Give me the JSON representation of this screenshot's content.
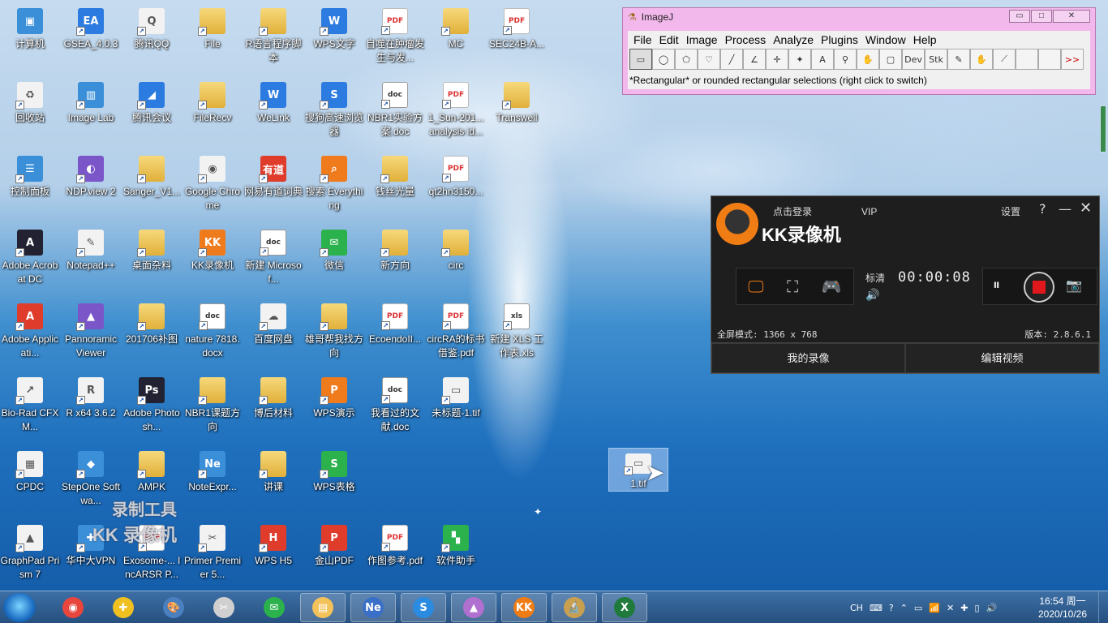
{
  "desktop_icons": [
    {
      "label": "计算机",
      "kind": "sys",
      "glyph": "▣"
    },
    {
      "label": "GSEA_4.0.3",
      "kind": "blue",
      "glyph": "EA"
    },
    {
      "label": "腾讯QQ",
      "kind": "white",
      "glyph": "Q"
    },
    {
      "label": "File",
      "kind": "folder",
      "glyph": ""
    },
    {
      "label": "R语言程序脚本",
      "kind": "folder",
      "glyph": ""
    },
    {
      "label": "WPS文字",
      "kind": "blue",
      "glyph": "W"
    },
    {
      "label": "自噬在肿瘤发生与发...",
      "kind": "pdf",
      "glyph": "PDF"
    },
    {
      "label": "MC",
      "kind": "folder",
      "glyph": ""
    },
    {
      "label": "SEC24B-A...",
      "kind": "pdf",
      "glyph": "PDF"
    },
    {
      "label": "回收站",
      "kind": "white",
      "glyph": "♻"
    },
    {
      "label": "Image Lab",
      "kind": "sys",
      "glyph": "▥"
    },
    {
      "label": "腾讯会议",
      "kind": "blue",
      "glyph": "◢"
    },
    {
      "label": "FileRecv",
      "kind": "folder",
      "glyph": ""
    },
    {
      "label": "WeLink",
      "kind": "blue",
      "glyph": "W"
    },
    {
      "label": "搜狗高速浏览器",
      "kind": "blue",
      "glyph": "S"
    },
    {
      "label": "NBR1实验方案.doc",
      "kind": "doc",
      "glyph": "doc"
    },
    {
      "label": "1_Sun-201... analysis id...",
      "kind": "pdf",
      "glyph": "PDF"
    },
    {
      "label": "Transwell",
      "kind": "folder",
      "glyph": ""
    },
    {
      "label": "控制面板",
      "kind": "sys",
      "glyph": "☰"
    },
    {
      "label": "NDP.view 2",
      "kind": "purple",
      "glyph": "◐"
    },
    {
      "label": "Sanger_V1...",
      "kind": "folder",
      "glyph": ""
    },
    {
      "label": "Google Chrome",
      "kind": "white",
      "glyph": "◉"
    },
    {
      "label": "网易有道词典",
      "kind": "red",
      "glyph": "有道"
    },
    {
      "label": "搜索 Everything",
      "kind": "orange",
      "glyph": "⌕"
    },
    {
      "label": "钱丝光量",
      "kind": "folder",
      "glyph": ""
    },
    {
      "label": "qt2hn3150...",
      "kind": "pdf",
      "glyph": "PDF"
    },
    {
      "label": "Adobe Acrobat DC",
      "kind": "dark",
      "glyph": "A"
    },
    {
      "label": "Notepad++",
      "kind": "white",
      "glyph": "✎"
    },
    {
      "label": "桌面杂料",
      "kind": "folder",
      "glyph": ""
    },
    {
      "label": "KK录像机",
      "kind": "orange",
      "glyph": "KK"
    },
    {
      "label": "新建 Microsof...",
      "kind": "doc",
      "glyph": "doc"
    },
    {
      "label": "微信",
      "kind": "green",
      "glyph": "✉"
    },
    {
      "label": "新方向",
      "kind": "folder",
      "glyph": ""
    },
    {
      "label": "circ",
      "kind": "folder",
      "glyph": ""
    },
    {
      "label": "Adobe Applicati...",
      "kind": "red",
      "glyph": "A"
    },
    {
      "label": "Pannoramic Viewer",
      "kind": "purple",
      "glyph": "▲"
    },
    {
      "label": "201706补图",
      "kind": "folder",
      "glyph": ""
    },
    {
      "label": "nature 7818.docx",
      "kind": "doc",
      "glyph": "doc"
    },
    {
      "label": "百度网盘",
      "kind": "white",
      "glyph": "☁"
    },
    {
      "label": "雄哥帮我找方向",
      "kind": "folder",
      "glyph": ""
    },
    {
      "label": "EcoendoII...",
      "kind": "pdf",
      "glyph": "PDF"
    },
    {
      "label": "circRA的标书借鉴.pdf",
      "kind": "pdf",
      "glyph": "PDF"
    },
    {
      "label": "新建 XLS 工作表.xls",
      "kind": "doc",
      "glyph": "xls"
    },
    {
      "label": "Bio-Rad CFX M...",
      "kind": "white",
      "glyph": "↗"
    },
    {
      "label": "R x64 3.6.2",
      "kind": "white",
      "glyph": "R"
    },
    {
      "label": "Adobe Photosh...",
      "kind": "dark",
      "glyph": "Ps"
    },
    {
      "label": "NBR1课题方向",
      "kind": "folder",
      "glyph": ""
    },
    {
      "label": "博后材料",
      "kind": "folder",
      "glyph": ""
    },
    {
      "label": "WPS演示",
      "kind": "orange",
      "glyph": "P"
    },
    {
      "label": "我看过的文献.doc",
      "kind": "doc",
      "glyph": "doc"
    },
    {
      "label": "未标题-1.tif",
      "kind": "white",
      "glyph": "▭"
    },
    {
      "label": "CPDC",
      "kind": "white",
      "glyph": "▦"
    },
    {
      "label": "StepOne Softwa...",
      "kind": "sys",
      "glyph": "◆"
    },
    {
      "label": "AMPK",
      "kind": "folder",
      "glyph": ""
    },
    {
      "label": "NoteExpr...",
      "kind": "sys",
      "glyph": "Ne"
    },
    {
      "label": "讲课",
      "kind": "folder",
      "glyph": ""
    },
    {
      "label": "WPS表格",
      "kind": "green",
      "glyph": "S"
    },
    {
      "label": "GraphPad Prism 7",
      "kind": "white",
      "glyph": "▲"
    },
    {
      "label": "华中大VPN",
      "kind": "sys",
      "glyph": "✚"
    },
    {
      "label": "Exosome-... lncARSR P...",
      "kind": "pdf",
      "glyph": "PDF"
    },
    {
      "label": "Primer Premier 5...",
      "kind": "white",
      "glyph": "✂"
    },
    {
      "label": "WPS H5",
      "kind": "red",
      "glyph": "H"
    },
    {
      "label": "金山PDF",
      "kind": "red",
      "glyph": "P"
    },
    {
      "label": "作图参考.pdf",
      "kind": "pdf",
      "glyph": "PDF"
    },
    {
      "label": "软件助手",
      "kind": "green",
      "glyph": "▚"
    },
    {
      "label": "1.tif",
      "kind": "white",
      "glyph": "▭"
    }
  ],
  "imagej": {
    "title": "ImageJ",
    "menu": [
      "File",
      "Edit",
      "Image",
      "Process",
      "Analyze",
      "Plugins",
      "Window",
      "Help"
    ],
    "tools": [
      "▭",
      "◯",
      "⬠",
      "♡",
      "╱",
      "∠",
      "✛",
      "✦",
      "A",
      "⚲",
      "✋",
      "▢",
      "Dev",
      "Stk",
      "✎",
      "✋",
      "⟋",
      "",
      "",
      ">>"
    ],
    "status": "*Rectangular* or rounded rectangular selections (right click to switch)",
    "controls": [
      "▭",
      "□",
      "✕"
    ]
  },
  "kk": {
    "login": "点击登录",
    "vip": "VIP",
    "settings": "设置",
    "help": "?",
    "minimize": "—",
    "close": "✕",
    "brand": "KK录像机",
    "quality": "标清",
    "time": "00:00:08",
    "mode_text": "全屏模式: 1366 x 768",
    "version": "版本: 2.8.6.1",
    "tab_mine": "我的录像",
    "tab_edit": "编辑视频",
    "modes": [
      "🖵",
      "⛶",
      "🎮"
    ]
  },
  "watermark": {
    "line1": "录制工具",
    "line2": "KK 录像机"
  },
  "taskbar": {
    "items": [
      {
        "name": "chrome",
        "glyph": "◉",
        "color": "#e8453c"
      },
      {
        "name": "vpn",
        "glyph": "✚",
        "color": "#f0c020"
      },
      {
        "name": "paint",
        "glyph": "🎨",
        "color": "#4a7fc0"
      },
      {
        "name": "tool",
        "glyph": "✂",
        "color": "#d0d0d0"
      },
      {
        "name": "wechat",
        "glyph": "✉",
        "color": "#2bb24c"
      },
      {
        "name": "explorer",
        "glyph": "▤",
        "color": "#f3c25a"
      },
      {
        "name": "noteexpress",
        "glyph": "Ne",
        "color": "#3a6fc8"
      },
      {
        "name": "sogou",
        "glyph": "S",
        "color": "#2a8be0"
      },
      {
        "name": "prism",
        "glyph": "▲",
        "color": "#b070d0"
      },
      {
        "name": "kk",
        "glyph": "KK",
        "color": "#f07c14"
      },
      {
        "name": "imagej",
        "glyph": "🔬",
        "color": "#c8a050"
      },
      {
        "name": "excel",
        "glyph": "X",
        "color": "#1f7a3c"
      }
    ],
    "tray": [
      "CH",
      "⌨",
      "?",
      "⌃",
      "▭",
      "📶",
      "✕",
      "✚",
      "▯",
      "🔊"
    ],
    "time": "16:54 周一",
    "date": "2020/10/26"
  }
}
